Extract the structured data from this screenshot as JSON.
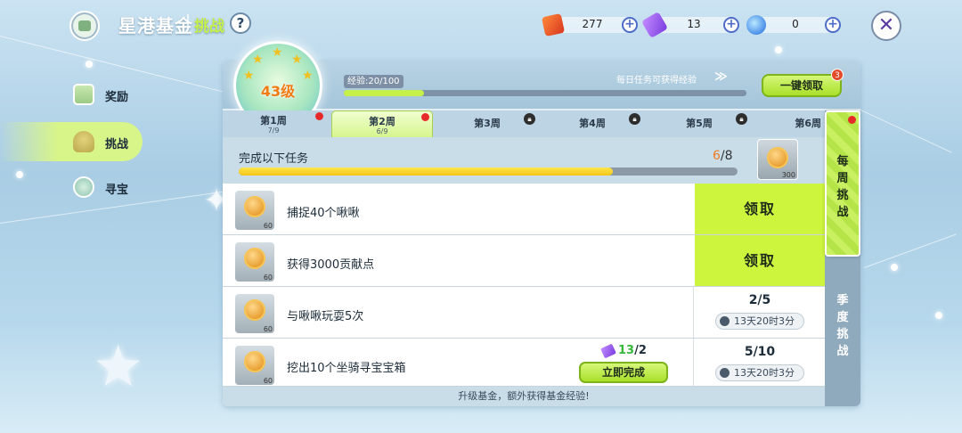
{
  "header": {
    "title": "星港基金",
    "subtitle": "挑战",
    "help_label": "?",
    "close_label": "✕"
  },
  "resources": [
    {
      "icon": "card-icon",
      "value": "277",
      "plus": "+"
    },
    {
      "icon": "ticket-icon",
      "value": "13",
      "plus": "+"
    },
    {
      "icon": "gem-icon",
      "value": "0",
      "plus": "+"
    }
  ],
  "sidebar": {
    "items": [
      {
        "label": "奖励",
        "icon": "gift-icon",
        "active": false
      },
      {
        "label": "挑战",
        "icon": "trophy-icon",
        "active": true
      },
      {
        "label": "寻宝",
        "icon": "treasure-icon",
        "active": false
      }
    ]
  },
  "level": {
    "text": "43级",
    "exp_label": "经验:20/100",
    "exp_progress": 0.2,
    "daily_hint": "每日任务可获得经验",
    "claim_all_label": "一键领取",
    "claim_all_badge": "3"
  },
  "weeks": [
    {
      "label": "第1周",
      "sub": "7/9",
      "state": "dot"
    },
    {
      "label": "第2周",
      "sub": "6/9",
      "state": "dot",
      "active": true
    },
    {
      "label": "第3周",
      "sub": "",
      "state": "lock"
    },
    {
      "label": "第4周",
      "sub": "",
      "state": "lock"
    },
    {
      "label": "第5周",
      "sub": "",
      "state": "lock"
    },
    {
      "label": "第6周",
      "sub": "",
      "state": "none"
    }
  ],
  "progress": {
    "title": "完成以下任务",
    "current": "6",
    "total": "/8",
    "fraction": 0.75,
    "reward_amount": "300"
  },
  "tasks": [
    {
      "name": "捕捉40个啾啾",
      "reward": "60",
      "claim_label": "领取",
      "status": "claim"
    },
    {
      "name": "获得3000贡献点",
      "reward": "60",
      "claim_label": "领取",
      "status": "claim"
    },
    {
      "name": "与啾啾玩耍5次",
      "reward": "60",
      "progress": "2/5",
      "timer": "13天20时3分",
      "status": "progress"
    },
    {
      "name": "挖出10个坐骑寻宝宝箱",
      "reward": "60",
      "progress": "5/10",
      "timer": "13天20时3分",
      "status": "progress",
      "quick": {
        "have": "13",
        "need": "/2",
        "label": "立即完成"
      }
    }
  ],
  "footer_hint": "升级基金，额外获得基金经验!",
  "side_tabs": {
    "weekly": "每周挑战",
    "season": "季度挑战"
  },
  "colors": {
    "accent_green": "#cef53e",
    "orange": "#f37b14",
    "red_dot": "#e62a2a"
  }
}
